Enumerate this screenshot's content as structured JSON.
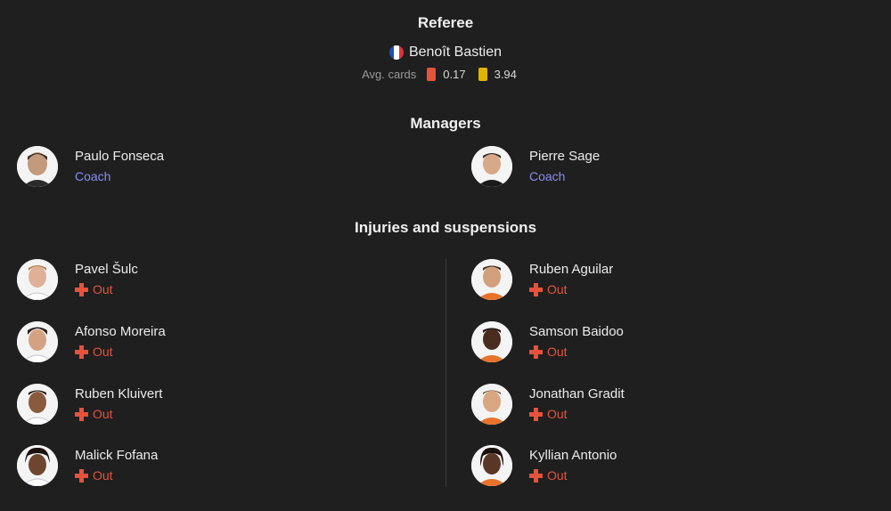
{
  "referee": {
    "title": "Referee",
    "name": "Benoît Bastien",
    "flag_icon": "france-flag-icon",
    "cards_label": "Avg. cards",
    "red_value": "0.17",
    "yellow_value": "3.94",
    "red_color": "#e5533d",
    "yellow_color": "#e0b400"
  },
  "managers": {
    "title": "Managers",
    "home": {
      "name": "Paulo Fonseca",
      "role": "Coach"
    },
    "away": {
      "name": "Pierre Sage",
      "role": "Coach"
    }
  },
  "injuries": {
    "title": "Injuries and suspensions",
    "status_icon": "injury-cross-icon",
    "home": [
      {
        "name": "Pavel Šulc",
        "status": "Out"
      },
      {
        "name": "Afonso Moreira",
        "status": "Out"
      },
      {
        "name": "Ruben Kluivert",
        "status": "Out"
      },
      {
        "name": "Malick Fofana",
        "status": "Out"
      }
    ],
    "away": [
      {
        "name": "Ruben Aguilar",
        "status": "Out"
      },
      {
        "name": "Samson Baidoo",
        "status": "Out"
      },
      {
        "name": "Jonathan Gradit",
        "status": "Out"
      },
      {
        "name": "Kyllian Antonio",
        "status": "Out"
      }
    ]
  },
  "colors": {
    "background": "#1f1f1f",
    "coach_role": "#8a8cf0",
    "status_out": "#e5533d"
  }
}
